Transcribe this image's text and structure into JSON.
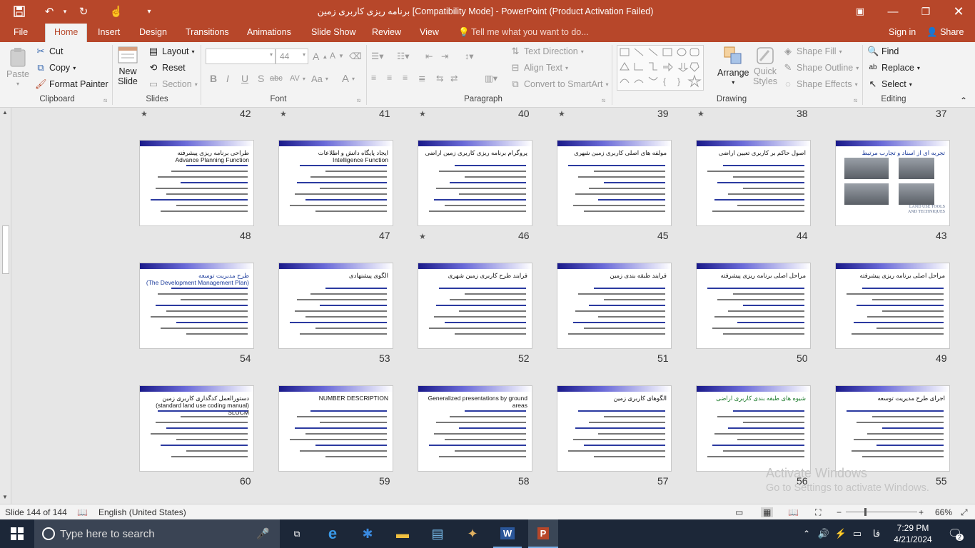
{
  "window": {
    "title": "برنامه ریزی کاربری زمین [Compatibility Mode] - PowerPoint (Product Activation Failed)",
    "quick_access": [
      "save-icon",
      "undo-icon",
      "redo-icon",
      "touch-mode-icon",
      "customize-icon"
    ],
    "controls": [
      "ribbon-display-icon",
      "minimize-icon",
      "restore-icon",
      "close-icon"
    ]
  },
  "tabs": {
    "file": "File",
    "home": "Home",
    "insert": "Insert",
    "design": "Design",
    "transitions": "Transitions",
    "animations": "Animations",
    "slideshow": "Slide Show",
    "review": "Review",
    "view": "View",
    "tellme": "Tell me what you want to do...",
    "signin": "Sign in",
    "share": "Share"
  },
  "ribbon": {
    "clipboard": {
      "paste": "Paste",
      "cut": "Cut",
      "copy": "Copy",
      "format_painter": "Format Painter",
      "label": "Clipboard"
    },
    "slides": {
      "new_slide_1": "New",
      "new_slide_2": "Slide",
      "layout": "Layout",
      "reset": "Reset",
      "section": "Section",
      "label": "Slides"
    },
    "font": {
      "font_size": "44",
      "label": "Font",
      "bold": "B",
      "italic": "I",
      "underline": "U",
      "strike": "S",
      "shadow": "abc",
      "spacing": "AV",
      "case": "Aa",
      "color": "A",
      "grow": "A",
      "shrink": "A"
    },
    "paragraph": {
      "text_direction": "Text Direction",
      "align_text": "Align Text",
      "convert_smartart": "Convert to SmartArt",
      "label": "Paragraph"
    },
    "drawing": {
      "arrange": "Arrange",
      "quick_styles_1": "Quick",
      "quick_styles_2": "Styles",
      "shape_fill": "Shape Fill",
      "shape_outline": "Shape Outline",
      "shape_effects": "Shape Effects",
      "label": "Drawing"
    },
    "editing": {
      "find": "Find",
      "replace": "Replace",
      "select": "Select",
      "label": "Editing"
    }
  },
  "sorter": {
    "top_numbers": [
      "37",
      "38",
      "39",
      "40",
      "41",
      "42"
    ],
    "rows": [
      {
        "slides": [
          {
            "number": "43",
            "title": "تجربه ای از اسناد و تجارب مرتبط",
            "style": "blue",
            "star": false,
            "picture_title": "LAND USE TOOLS AND TECHNIQUES"
          },
          {
            "number": "44",
            "title": "اصول حاکم بر کاربری تعیین اراضی",
            "style": "",
            "star": false
          },
          {
            "number": "45",
            "title": "مولفه های اصلی کاربری زمین شهری",
            "style": "",
            "star": false
          },
          {
            "number": "46",
            "title": "پروگرام برنامه ریزی کاربری زمین اراضی",
            "style": "",
            "star": true
          },
          {
            "number": "47",
            "title": "ایجاد پایگاه دانش و اطلاعات\nIntelligence Function",
            "style": "",
            "star": false
          },
          {
            "number": "48",
            "title": "طراحی برنامه ریزی پیشرفته\nAdvance Planning Function",
            "style": "",
            "star": false
          }
        ]
      },
      {
        "slides": [
          {
            "number": "49",
            "title": "مراحل اصلی برنامه ریزی پیشرفته",
            "style": "",
            "star": false
          },
          {
            "number": "50",
            "title": "مراحل اصلی برنامه ریزی پیشرفته",
            "style": "",
            "star": false
          },
          {
            "number": "51",
            "title": "فرایند طبقه بندی زمین",
            "style": "",
            "star": false
          },
          {
            "number": "52",
            "title": "فرایند طرح کاربری زمین شهری",
            "style": "",
            "star": false
          },
          {
            "number": "53",
            "title": "الگوی پیشنهادی",
            "style": "",
            "star": false
          },
          {
            "number": "54",
            "title": "طرح مدیریت توسعه\n(The Development Management Plan)",
            "style": "blue",
            "star": false
          }
        ]
      },
      {
        "slides": [
          {
            "number": "55",
            "title": "اجرای طرح مدیریت توسعه",
            "style": "",
            "star": false
          },
          {
            "number": "56",
            "title": "شیوه های طبقه بندی کاربری اراضی",
            "style": "green",
            "star": false
          },
          {
            "number": "57",
            "title": "الگوهای کاربری زمین",
            "style": "",
            "star": false
          },
          {
            "number": "58",
            "title": "Generalized presentations by ground areas",
            "style": "",
            "star": false
          },
          {
            "number": "59",
            "title": "NUMBER DESCRIPTION",
            "style": "",
            "star": false
          },
          {
            "number": "60",
            "title": "دستورالعمل کدگذاری کاربری زمین\n(standard land use coding manual) SLUCM",
            "style": "",
            "star": false
          }
        ]
      }
    ]
  },
  "status": {
    "slide": "Slide 144 of 144",
    "language": "English (United States)",
    "zoom": "66%"
  },
  "watermark": {
    "line1": "Activate Windows",
    "line2": "Go to Settings to activate Windows."
  },
  "taskbar": {
    "search_placeholder": "Type here to search",
    "time": "7:29 PM",
    "date": "4/21/2024",
    "lang": "فا",
    "notifications": "2"
  },
  "colors": {
    "accent": "#b7472a",
    "taskbar": "#1c2738"
  }
}
